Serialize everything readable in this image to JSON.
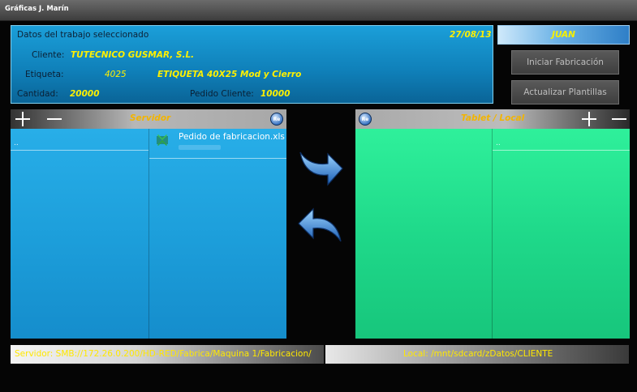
{
  "window": {
    "title": "Gráficas J. Marín"
  },
  "job": {
    "header": "Datos del trabajo seleccionado",
    "date": "27/08/13",
    "cliente_label": "Cliente:",
    "cliente_value": "TUTECNICO GUSMAR, S.L.",
    "etiqueta_label": "Etiqueta:",
    "etiqueta_code": "4025",
    "etiqueta_desc": "ETIQUETA 40X25 Mod y Cierro",
    "cantidad_label": "Cantidad:",
    "cantidad_value": "20000",
    "pedido_label": "Pedido Cliente:",
    "pedido_value": "10000"
  },
  "user": {
    "name": "JUAN"
  },
  "actions": {
    "iniciar": "Iniciar Fabricación",
    "actualizar": "Actualizar Plantillas"
  },
  "servidor": {
    "title": "Servidor",
    "icon_text": "Re",
    "parent_item": "..",
    "files": [
      {
        "name": "Pedido de fabricacion.xls",
        "icon": "excel-file-icon"
      }
    ],
    "path": "Servidor: SMB://172.26.0.200/HD-RED/Fabrica/Maquina 1/Fabricacion/"
  },
  "local": {
    "title": "Tablet / Local",
    "icon_text": "Re",
    "parent_item": "..",
    "path": "Local: /mnt/sdcard/zDatos/CLIENTE"
  },
  "colors": {
    "accent_yellow": "#fff000",
    "server_blue": "#1d9fdb",
    "local_green": "#1fd98a",
    "header_orange": "#f2b400"
  }
}
